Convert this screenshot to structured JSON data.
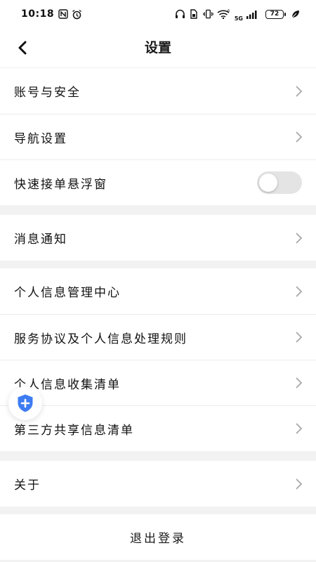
{
  "status_bar": {
    "time": "10:18",
    "network": "5G",
    "battery": "72",
    "icons": [
      "nfc-icon",
      "alarm-icon",
      "headphones-icon",
      "sim-icon",
      "vibrate-icon",
      "wifi-icon",
      "signal-icon",
      "battery-icon",
      "leaf-icon"
    ]
  },
  "header": {
    "title": "设置",
    "back_icon": "chevron-left-icon"
  },
  "groups": [
    {
      "items": [
        {
          "label": "账号与安全",
          "type": "link"
        },
        {
          "label": "导航设置",
          "type": "link"
        },
        {
          "label": "快速接单悬浮窗",
          "type": "toggle",
          "value": false
        }
      ]
    },
    {
      "items": [
        {
          "label": "消息通知",
          "type": "link"
        }
      ]
    },
    {
      "items": [
        {
          "label": "个人信息管理中心",
          "type": "link"
        },
        {
          "label": "服务协议及个人信息处理规则",
          "type": "link"
        },
        {
          "label": "个人信息收集清单",
          "type": "link"
        },
        {
          "label": "第三方共享信息清单",
          "type": "link"
        }
      ]
    },
    {
      "items": [
        {
          "label": "关于",
          "type": "link"
        }
      ]
    }
  ],
  "logout_label": "退出登录",
  "floating_button": {
    "icon": "shield-plus-icon"
  },
  "colors": {
    "background": "#f2f2f2",
    "card": "#ffffff",
    "shield": "#3d7cf2",
    "toggle_off": "#e4e4e4",
    "chevron": "#a8a8a8"
  }
}
